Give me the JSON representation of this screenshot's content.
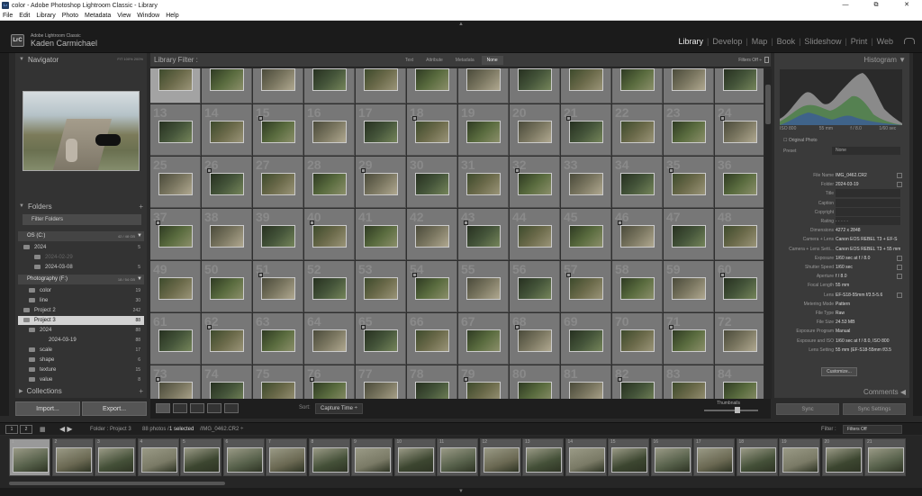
{
  "window": {
    "title": "color - Adobe Photoshop Lightroom Classic - Library",
    "minimize": "—",
    "maximize": "⧉",
    "close": "✕"
  },
  "menu": [
    "File",
    "Edit",
    "Library",
    "Photo",
    "Metadata",
    "View",
    "Window",
    "Help"
  ],
  "identity": {
    "badge": "LrC",
    "product": "Adobe Lightroom Classic",
    "user": "Kaden Carmichael"
  },
  "modules": [
    "Library",
    "Develop",
    "Map",
    "Book",
    "Slideshow",
    "Print",
    "Web"
  ],
  "navigator": {
    "title": "Navigator",
    "zoom": "FIT    100%    200%"
  },
  "folders": {
    "title": "Folders",
    "add": "+",
    "filter_placeholder": "Filter Folders",
    "volume1": {
      "name": "OS (C:)",
      "usage": "42 / 48 GB"
    },
    "volume2": {
      "name": "Photography (F:)",
      "usage": "18 / 54 GB"
    },
    "rows": [
      {
        "name": "2024",
        "count": "5"
      },
      {
        "name": "2024-02-29",
        "count": ""
      },
      {
        "name": "2024-03-08",
        "count": "5"
      },
      {
        "name": "color",
        "count": "19"
      },
      {
        "name": "line",
        "count": "30"
      },
      {
        "name": "Project 2",
        "count": "242"
      },
      {
        "name": "Project 3",
        "count": "88"
      },
      {
        "name": "2024",
        "count": "88"
      },
      {
        "name": "2024-03-19",
        "count": "88"
      },
      {
        "name": "scale",
        "count": "17"
      },
      {
        "name": "shape",
        "count": "6"
      },
      {
        "name": "texture",
        "count": "15"
      },
      {
        "name": "value",
        "count": "8"
      }
    ]
  },
  "collections": {
    "title": "Collections",
    "add": "+"
  },
  "buttons": {
    "import": "Import...",
    "export": "Export...",
    "sync": "Sync",
    "sync_settings": "Sync Settings",
    "customize": "Customize..."
  },
  "library_filter": {
    "title": "Library Filter :",
    "tabs": [
      "Text",
      "Attribute",
      "Metadata",
      "None"
    ],
    "active": "None",
    "filters_off": "Filters Off ÷"
  },
  "grid": {
    "row_numbers": [
      [
        "",
        "",
        "",
        "",
        "",
        "",
        "",
        "",
        "",
        "",
        "",
        ""
      ],
      [
        "13",
        "14",
        "15",
        "16",
        "17",
        "18",
        "19",
        "20",
        "21",
        "22",
        "23",
        "24"
      ],
      [
        "25",
        "26",
        "27",
        "28",
        "29",
        "30",
        "31",
        "32",
        "33",
        "34",
        "35",
        "36"
      ],
      [
        "37",
        "38",
        "39",
        "40",
        "41",
        "42",
        "43",
        "44",
        "45",
        "46",
        "47",
        "48"
      ],
      [
        "49",
        "50",
        "51",
        "52",
        "53",
        "54",
        "55",
        "56",
        "57",
        "58",
        "59",
        "60"
      ],
      [
        "61",
        "62",
        "63",
        "64",
        "65",
        "66",
        "67",
        "68",
        "69",
        "70",
        "71",
        "72"
      ],
      [
        "73",
        "74",
        "75",
        "76",
        "77",
        "78",
        "79",
        "80",
        "81",
        "82",
        "83",
        "84"
      ]
    ]
  },
  "toolbar": {
    "sort_label": "Sort:",
    "sort_value": "Capture Time ÷",
    "thumbnails": "Thumbnails"
  },
  "histogram": {
    "title": "Histogram",
    "iso": "ISO 800",
    "focal": "55 mm",
    "aperture": "f / 8.0",
    "shutter": "1/60 sec",
    "original": "Original Photo"
  },
  "metadata": {
    "preset_label": "Preset",
    "preset_value": "None",
    "rows": [
      {
        "label": "File Name",
        "value": "IMG_0462.CR2"
      },
      {
        "label": "Folder",
        "value": "2024-03-19"
      },
      {
        "label": "Title",
        "value": ""
      },
      {
        "label": "Caption",
        "value": ""
      },
      {
        "label": "Copyright",
        "value": ""
      },
      {
        "label": "Rating",
        "value": "·  ·  ·  ·  ·"
      },
      {
        "label": "Dimensions",
        "value": "4272 x 2848"
      },
      {
        "label": "Camera + Lens",
        "value": "Canon EOS REBEL T3 + EF-S"
      },
      {
        "label": "Camera + Lens Setti...",
        "value": "Canon EOS REBEL T3 + 55 mm"
      },
      {
        "label": "Exposure",
        "value": "1/60 sec at f / 8.0"
      },
      {
        "label": "Shutter Speed",
        "value": "1/60 sec"
      },
      {
        "label": "Aperture",
        "value": "f / 8.0"
      },
      {
        "label": "Focal Length",
        "value": "55 mm"
      },
      {
        "label": "Lens",
        "value": "EF-S18-55mm f/3.5-5.6"
      },
      {
        "label": "Metering Mode",
        "value": "Pattern"
      },
      {
        "label": "File Type",
        "value": "Raw"
      },
      {
        "label": "File Size",
        "value": "24.53 MB"
      },
      {
        "label": "Exposure Program",
        "value": "Manual"
      },
      {
        "label": "Exposure and ISO",
        "value": "1/60 sec at f / 8.0, ISO 800"
      },
      {
        "label": "Lens Setting",
        "value": "55 mm (EF-S18-55mm f/3.5"
      }
    ]
  },
  "comments": {
    "title": "Comments"
  },
  "statusbar": {
    "screen1": "1",
    "screen2": "2",
    "path": "Folder : Project 3",
    "count": "88 photos /",
    "selected": "1 selected",
    "file": "/IMG_0462.CR2 ÷",
    "filter_label": "Filter :",
    "filter_value": "Filters Off"
  },
  "filmstrip": {
    "numbers": [
      "1",
      "2",
      "3",
      "4",
      "5",
      "6",
      "7",
      "8",
      "9",
      "10",
      "11",
      "12",
      "13",
      "14",
      "15",
      "16",
      "17",
      "18",
      "19",
      "20",
      "21"
    ]
  },
  "colors": {
    "accent": "#eeeeee",
    "panel": "#333333",
    "grid_cell": "#777777",
    "selected_cell": "#a3a3a3"
  }
}
